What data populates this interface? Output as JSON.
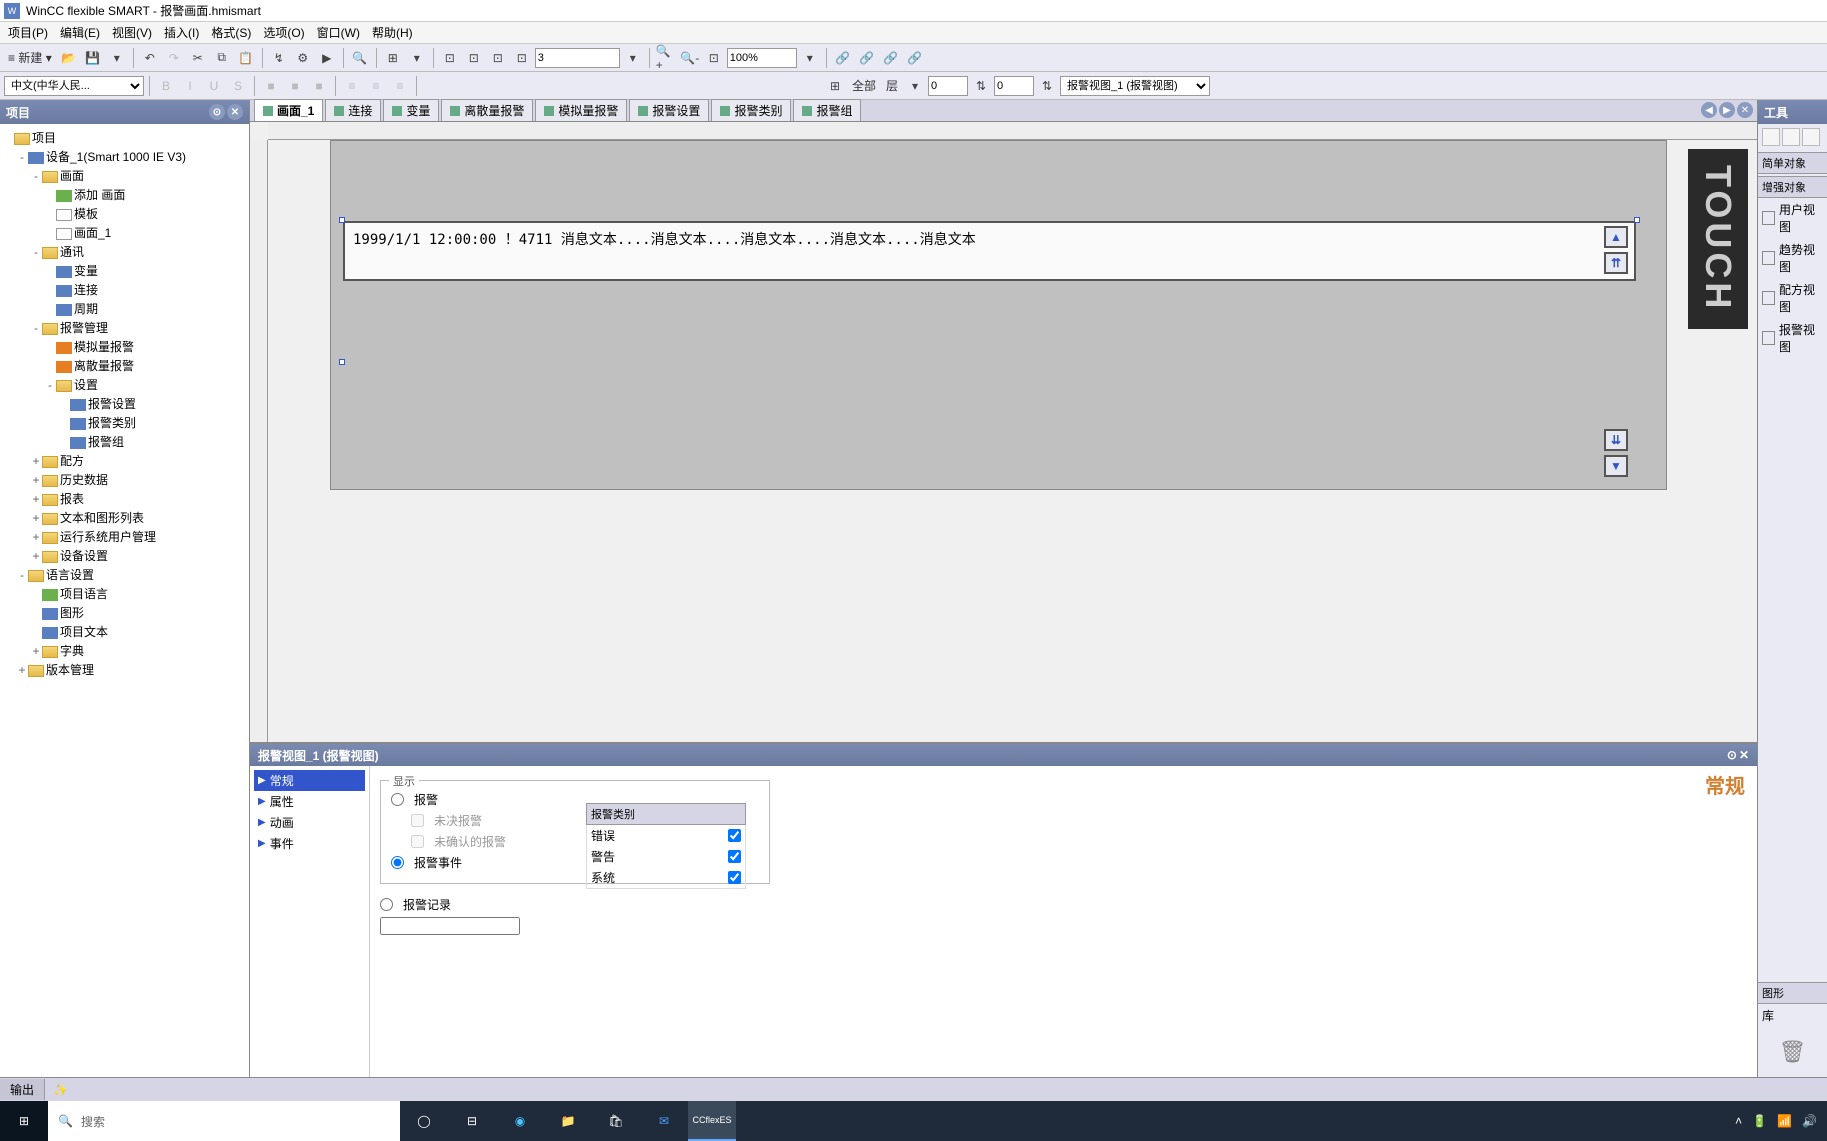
{
  "title": "WinCC flexible SMART - 报警画面.hmismart",
  "menu": [
    "项目(P)",
    "编辑(E)",
    "视图(V)",
    "插入(I)",
    "格式(S)",
    "选项(O)",
    "窗口(W)",
    "帮助(H)"
  ],
  "toolbar1": {
    "new_label": "新建",
    "num_input": "3",
    "zoom": "100%"
  },
  "toolbar2": {
    "lang_select": "中文(中华人民...",
    "all_label": "全部",
    "layer_label": "层",
    "x": "0",
    "y": "0",
    "object_select": "报警视图_1 (报警视图)"
  },
  "project_panel": {
    "title": "项目",
    "root": "项目",
    "nodes": [
      {
        "ind": 1,
        "label": "设备_1(Smart 1000 IE V3)",
        "toggle": "-",
        "ico": "ico-blue"
      },
      {
        "ind": 2,
        "label": "画面",
        "toggle": "-",
        "ico": "ico-folder"
      },
      {
        "ind": 3,
        "label": "添加 画面",
        "toggle": "",
        "ico": "ico-green"
      },
      {
        "ind": 3,
        "label": "模板",
        "toggle": "",
        "ico": "ico-screen"
      },
      {
        "ind": 3,
        "label": "画面_1",
        "toggle": "",
        "ico": "ico-screen"
      },
      {
        "ind": 2,
        "label": "通讯",
        "toggle": "-",
        "ico": "ico-folder"
      },
      {
        "ind": 3,
        "label": "变量",
        "toggle": "",
        "ico": "ico-blue"
      },
      {
        "ind": 3,
        "label": "连接",
        "toggle": "",
        "ico": "ico-blue"
      },
      {
        "ind": 3,
        "label": "周期",
        "toggle": "",
        "ico": "ico-blue"
      },
      {
        "ind": 2,
        "label": "报警管理",
        "toggle": "-",
        "ico": "ico-folder"
      },
      {
        "ind": 3,
        "label": "模拟量报警",
        "toggle": "",
        "ico": "ico-orange"
      },
      {
        "ind": 3,
        "label": "离散量报警",
        "toggle": "",
        "ico": "ico-orange"
      },
      {
        "ind": 3,
        "label": "设置",
        "toggle": "-",
        "ico": "ico-folder"
      },
      {
        "ind": 4,
        "label": "报警设置",
        "toggle": "",
        "ico": "ico-blue"
      },
      {
        "ind": 4,
        "label": "报警类别",
        "toggle": "",
        "ico": "ico-blue"
      },
      {
        "ind": 4,
        "label": "报警组",
        "toggle": "",
        "ico": "ico-blue"
      },
      {
        "ind": 2,
        "label": "配方",
        "toggle": "+",
        "ico": "ico-folder"
      },
      {
        "ind": 2,
        "label": "历史数据",
        "toggle": "+",
        "ico": "ico-folder"
      },
      {
        "ind": 2,
        "label": "报表",
        "toggle": "+",
        "ico": "ico-folder"
      },
      {
        "ind": 2,
        "label": "文本和图形列表",
        "toggle": "+",
        "ico": "ico-folder"
      },
      {
        "ind": 2,
        "label": "运行系统用户管理",
        "toggle": "+",
        "ico": "ico-folder"
      },
      {
        "ind": 2,
        "label": "设备设置",
        "toggle": "+",
        "ico": "ico-folder"
      },
      {
        "ind": 1,
        "label": "语言设置",
        "toggle": "-",
        "ico": "ico-folder"
      },
      {
        "ind": 2,
        "label": "项目语言",
        "toggle": "",
        "ico": "ico-green"
      },
      {
        "ind": 2,
        "label": "图形",
        "toggle": "",
        "ico": "ico-blue"
      },
      {
        "ind": 2,
        "label": "项目文本",
        "toggle": "",
        "ico": "ico-blue"
      },
      {
        "ind": 2,
        "label": "字典",
        "toggle": "+",
        "ico": "ico-folder"
      },
      {
        "ind": 1,
        "label": "版本管理",
        "toggle": "+",
        "ico": "ico-folder"
      }
    ]
  },
  "tabs": [
    {
      "label": "画面_1",
      "active": true
    },
    {
      "label": "连接",
      "active": false
    },
    {
      "label": "变量",
      "active": false
    },
    {
      "label": "离散量报警",
      "active": false
    },
    {
      "label": "模拟量报警",
      "active": false
    },
    {
      "label": "报警设置",
      "active": false
    },
    {
      "label": "报警类别",
      "active": false
    },
    {
      "label": "报警组",
      "active": false
    }
  ],
  "canvas": {
    "alarm_text": "1999/1/1 12:00:00 ！4711 消息文本....消息文本....消息文本....消息文本....消息文本",
    "touch_label": "TOUCH"
  },
  "props": {
    "header": "报警视图_1 (报警视图)",
    "title": "常规",
    "tree": [
      {
        "label": "常规",
        "sel": true
      },
      {
        "label": "属性",
        "sel": false
      },
      {
        "label": "动画",
        "sel": false
      },
      {
        "label": "事件",
        "sel": false
      }
    ],
    "group_display": "显示",
    "radio_alarm": "报警",
    "chk_unacked": "未决报警",
    "chk_unconf": "未确认的报警",
    "radio_event": "报警事件",
    "radio_log": "报警记录",
    "class_header": "报警类别",
    "classes": [
      {
        "name": "错误",
        "checked": true
      },
      {
        "name": "警告",
        "checked": true
      },
      {
        "name": "系统",
        "checked": true
      }
    ]
  },
  "right_panel": {
    "title": "工具",
    "section1": "简单对象",
    "section2": "增强对象",
    "views": [
      "用户视图",
      "趋势视图",
      "配方视图",
      "报警视图"
    ]
  },
  "right_panel2": {
    "title": "图形",
    "lib": "库"
  },
  "output_tab": "输出",
  "taskbar": {
    "search_placeholder": "搜索",
    "app": "CCflexES"
  }
}
